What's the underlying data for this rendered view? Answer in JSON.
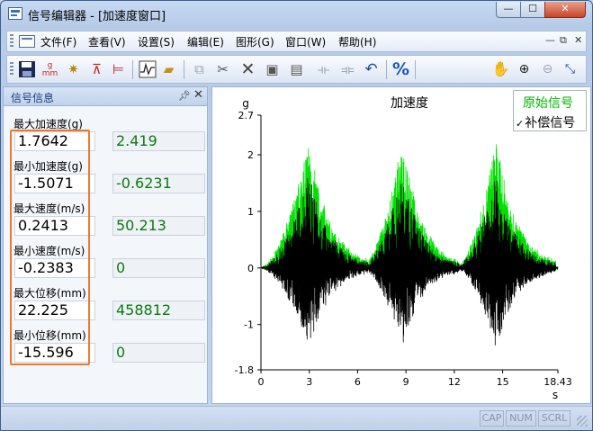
{
  "window": {
    "title": "信号编辑器 - [加速度窗口]",
    "min_glyph": "—",
    "max_glyph": "☐",
    "close_glyph": "✕"
  },
  "menu": {
    "items": [
      "文件(F)",
      "查看(V)",
      "设置(S)",
      "编辑(E)",
      "图形(G)",
      "窗口(W)",
      "帮助(H)"
    ],
    "mdi_min": "—",
    "mdi_restore": "⧉",
    "mdi_close": "✕"
  },
  "toolbar": {
    "icons": [
      "save-icon",
      "unit-gmm-icon",
      "filter-icon",
      "clip-icon",
      "clip-alt-icon",
      "waveform-icon",
      "open-folder-icon",
      "copy-icon",
      "cut-icon",
      "delete-icon",
      "paste-icon",
      "paste-alt-icon",
      "insert-icon",
      "shift-icon",
      "undo-icon",
      "percent-icon",
      "hand-icon",
      "zoom-in-icon",
      "zoom-out-icon",
      "fit-icon"
    ],
    "unit_g": "g",
    "unit_mm": "mm",
    "percent": "%"
  },
  "panel": {
    "title": "信号信息",
    "rows": [
      {
        "label": "最大加速度(g)",
        "value": "1.7642",
        "value2": "2.419"
      },
      {
        "label": "最小加速度(g)",
        "value": "-1.5071",
        "value2": "-0.6231"
      },
      {
        "label": "最大速度(m/s)",
        "value": "0.2413",
        "value2": "50.213"
      },
      {
        "label": "最小速度(m/s)",
        "value": "-0.2383",
        "value2": "0"
      },
      {
        "label": "最大位移(mm)",
        "value": "22.225",
        "value2": "458812"
      },
      {
        "label": "最小位移(mm)",
        "value": "-15.596",
        "value2": "0"
      }
    ],
    "highlight_color": "#ec7a2c"
  },
  "chart_data": {
    "type": "line",
    "title": "加速度",
    "ylabel": "g",
    "xlabel": "s",
    "xlim": [
      0,
      18.43
    ],
    "ylim": [
      -1.8,
      2.7
    ],
    "x_ticks": [
      "0",
      "3",
      "6",
      "9",
      "12",
      "15",
      "18.43"
    ],
    "x_tick_values": [
      0,
      3,
      6,
      9,
      12,
      15,
      18.43
    ],
    "y_ticks": [
      "2.7",
      "2",
      "1",
      "0",
      "-1",
      "-1.8"
    ],
    "y_tick_values": [
      2.7,
      2,
      1,
      0,
      -1,
      -1.8
    ],
    "legend": {
      "placement": "top-right",
      "checked_series": "补偿信号"
    },
    "bursts": [
      {
        "start": 0.0,
        "peak": 3.0,
        "end": 6.8
      },
      {
        "start": 6.2,
        "peak": 8.8,
        "end": 12.3
      },
      {
        "start": 12.1,
        "peak": 14.6,
        "end": 18.3
      }
    ],
    "series": [
      {
        "name": "原始信号",
        "color": "#00e000",
        "max": 2.419,
        "min": -0.6231
      },
      {
        "name": "补偿信号",
        "color": "#000000",
        "max": 1.7642,
        "min": -1.5071
      }
    ]
  },
  "status": {
    "cap": "CAP",
    "num": "NUM",
    "scrl": "SCRL"
  }
}
